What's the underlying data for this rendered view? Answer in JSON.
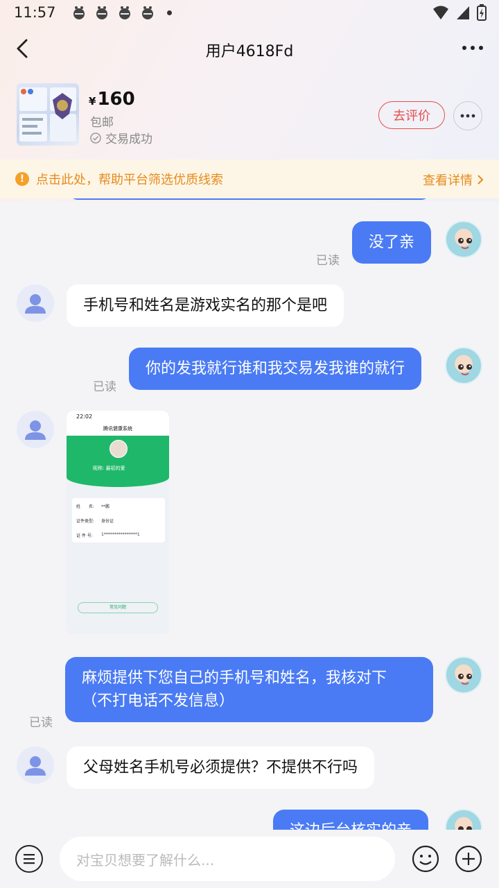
{
  "status_bar": {
    "time": "11:57"
  },
  "nav": {
    "title": "用户4618Fd"
  },
  "product": {
    "currency": "¥",
    "price": "160",
    "shipping": "包邮",
    "status": "交易成功",
    "review_label": "去评价"
  },
  "notice": {
    "text": "点击此处，帮助平台筛选优质线索",
    "link": "查看详情"
  },
  "messages": [
    {
      "from": "me",
      "text": "没了亲",
      "read": "已读"
    },
    {
      "from": "them",
      "text": "手机号和姓名是游戏实名的那个是吧"
    },
    {
      "from": "me",
      "text": "你的发我就行谁和我交易发我谁的就行",
      "read": "已读"
    },
    {
      "from": "them",
      "type": "image"
    },
    {
      "from": "me",
      "text_line1": "麻烦提供下您自己的手机号和姓名，我核对下",
      "text_line2": "（不打电话不发信息）",
      "read": "已读"
    },
    {
      "from": "them",
      "text": "父母姓名手机号必须提供？不提供不行吗"
    },
    {
      "from": "me",
      "text": "这边后台核实的亲"
    }
  ],
  "image_msg": {
    "time": "22:02",
    "app_title": "腾讯健康系统",
    "user_name": "昵称: 最初的爱",
    "field1_label": "姓　　名:",
    "field1_value": "**鹏",
    "field2_label": "证件类型:",
    "field2_value": "身份证",
    "field3_label": "证 件 号:",
    "field3_value": "1****************1",
    "button": "常见问题"
  },
  "input": {
    "placeholder": "对宝贝想要了解什么..."
  }
}
